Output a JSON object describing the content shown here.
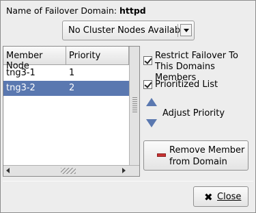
{
  "header": {
    "name_label": "Name of Failover Domain:",
    "name_value": "httpd"
  },
  "nodes_combo": {
    "selected": "No Cluster Nodes Available"
  },
  "member_table": {
    "columns": [
      "Member Node",
      "Priority"
    ],
    "rows": [
      {
        "node": "tng3-1",
        "priority": "1"
      },
      {
        "node": "tng3-2",
        "priority": "2"
      }
    ],
    "selected_row": 1
  },
  "options": {
    "restrict_label": "Restrict Failover To This Domains Members",
    "restrict_checked": true,
    "prioritized_label": "Prioritized List",
    "prioritized_checked": true
  },
  "priority": {
    "adjust_label": "Adjust Priority",
    "up_icon": "arrow-up-icon",
    "down_icon": "arrow-down-icon"
  },
  "remove_button": {
    "label": "Remove Member from Domain",
    "icon": "minus-icon"
  },
  "close_button": {
    "label": "Close",
    "icon": "close-x-icon"
  },
  "colors": {
    "selection": "#5a78b0",
    "dialog_bg": "#ededed",
    "remove_icon": "#c83232"
  }
}
